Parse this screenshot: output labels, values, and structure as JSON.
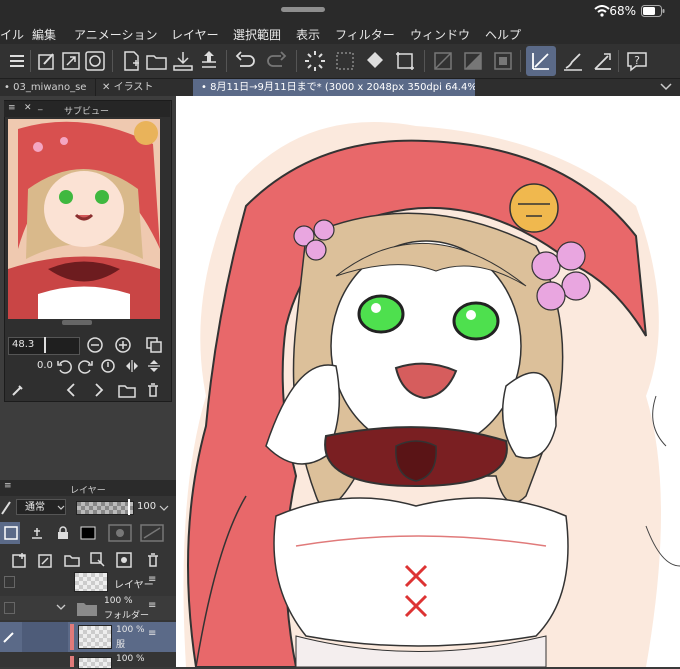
{
  "status": {
    "battery": "68%"
  },
  "menu": [
    "イル",
    "編集",
    "アニメーション",
    "レイヤー",
    "選択範囲",
    "表示",
    "フィルター",
    "ウィンドウ",
    "ヘルプ"
  ],
  "tabs": [
    {
      "label": "03_miwano_se"
    },
    {
      "label": "イラスト"
    },
    {
      "label": "8月11日→9月11日まで* (3000 x 2048px 350dpi 64.4%)"
    }
  ],
  "subview": {
    "title": "サブビュー",
    "zoom": "48.3",
    "rotation": "0.0"
  },
  "layers": {
    "title": "レイヤー",
    "blend_mode": "通常",
    "opacity": "100",
    "rows": [
      {
        "opacity": "",
        "name": "レイヤー"
      },
      {
        "opacity": "100 %",
        "name": "フォルダー"
      },
      {
        "opacity": "100 %",
        "name": "服"
      },
      {
        "opacity": "100 %",
        "name": ""
      }
    ]
  },
  "colors": {
    "accent": "#5b6a88",
    "hood": "#e8686a",
    "hair": "#dcc09a",
    "eye": "#4ee04e",
    "bra": "#7a1f22"
  },
  "icons": [
    "wifi-icon",
    "battery-icon",
    "hamburger-icon",
    "undo-icon",
    "redo-icon",
    "help-icon"
  ]
}
